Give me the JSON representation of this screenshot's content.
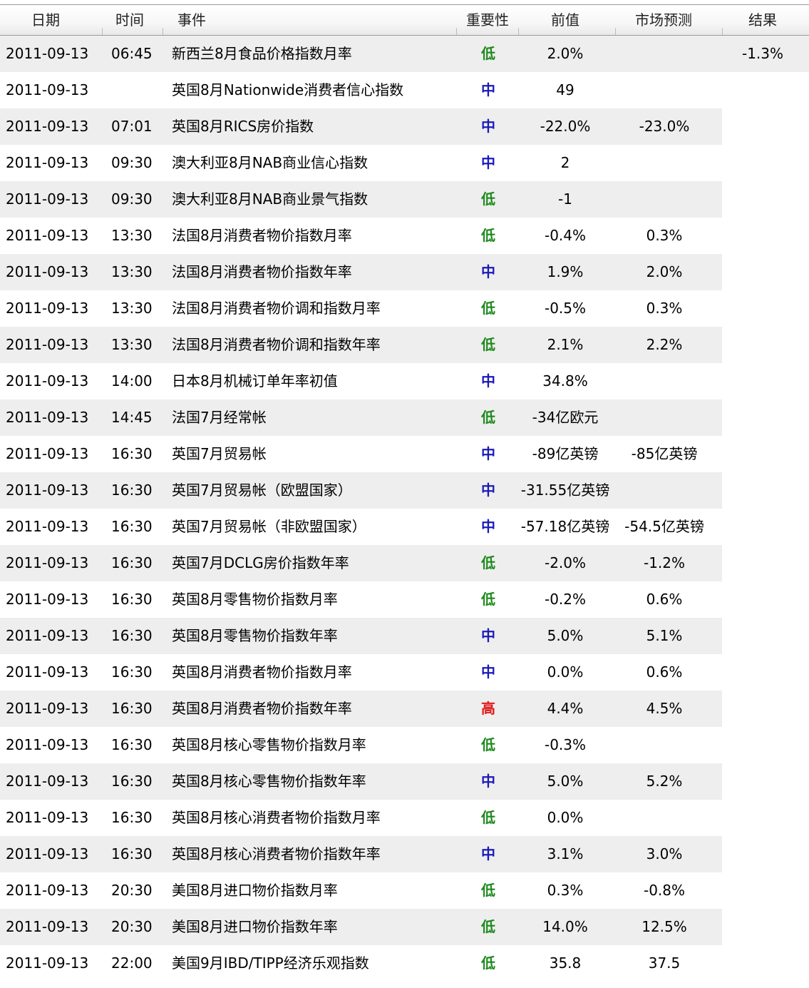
{
  "header": {
    "date": "日期",
    "time": "时间",
    "event": "事件",
    "importance": "重要性",
    "previous": "前值",
    "forecast": "市场预测",
    "result": "结果"
  },
  "importance_colors": {
    "低": "#1f8a1f",
    "中": "#1a1ab8",
    "高": "#e01818"
  },
  "rows": [
    {
      "date": "2011-09-13",
      "time": "06:45",
      "event": "新西兰8月食品价格指数月率",
      "importance": "低",
      "previous": "2.0%",
      "forecast": "",
      "result": "-1.3%"
    },
    {
      "date": "2011-09-13",
      "time": "",
      "event": "英国8月Nationwide消费者信心指数",
      "importance": "中",
      "previous": "49",
      "forecast": "",
      "result": ""
    },
    {
      "date": "2011-09-13",
      "time": "07:01",
      "event": "英国8月RICS房价指数",
      "importance": "中",
      "previous": "-22.0%",
      "forecast": "-23.0%",
      "result": ""
    },
    {
      "date": "2011-09-13",
      "time": "09:30",
      "event": "澳大利亚8月NAB商业信心指数",
      "importance": "中",
      "previous": "2",
      "forecast": "",
      "result": ""
    },
    {
      "date": "2011-09-13",
      "time": "09:30",
      "event": "澳大利亚8月NAB商业景气指数",
      "importance": "低",
      "previous": "-1",
      "forecast": "",
      "result": ""
    },
    {
      "date": "2011-09-13",
      "time": "13:30",
      "event": "法国8月消费者物价指数月率",
      "importance": "低",
      "previous": "-0.4%",
      "forecast": "0.3%",
      "result": ""
    },
    {
      "date": "2011-09-13",
      "time": "13:30",
      "event": "法国8月消费者物价指数年率",
      "importance": "中",
      "previous": "1.9%",
      "forecast": "2.0%",
      "result": ""
    },
    {
      "date": "2011-09-13",
      "time": "13:30",
      "event": "法国8月消费者物价调和指数月率",
      "importance": "低",
      "previous": "-0.5%",
      "forecast": "0.3%",
      "result": ""
    },
    {
      "date": "2011-09-13",
      "time": "13:30",
      "event": "法国8月消费者物价调和指数年率",
      "importance": "低",
      "previous": "2.1%",
      "forecast": "2.2%",
      "result": ""
    },
    {
      "date": "2011-09-13",
      "time": "14:00",
      "event": "日本8月机械订单年率初值",
      "importance": "中",
      "previous": "34.8%",
      "forecast": "",
      "result": ""
    },
    {
      "date": "2011-09-13",
      "time": "14:45",
      "event": "法国7月经常帐",
      "importance": "低",
      "previous": "-34亿欧元",
      "forecast": "",
      "result": ""
    },
    {
      "date": "2011-09-13",
      "time": "16:30",
      "event": "英国7月贸易帐",
      "importance": "中",
      "previous": "-89亿英镑",
      "forecast": "-85亿英镑",
      "result": ""
    },
    {
      "date": "2011-09-13",
      "time": "16:30",
      "event": "英国7月贸易帐（欧盟国家）",
      "importance": "中",
      "previous": "-31.55亿英镑",
      "forecast": "",
      "result": ""
    },
    {
      "date": "2011-09-13",
      "time": "16:30",
      "event": "英国7月贸易帐（非欧盟国家）",
      "importance": "中",
      "previous": "-57.18亿英镑",
      "forecast": "-54.5亿英镑",
      "result": ""
    },
    {
      "date": "2011-09-13",
      "time": "16:30",
      "event": "英国7月DCLG房价指数年率",
      "importance": "低",
      "previous": "-2.0%",
      "forecast": "-1.2%",
      "result": ""
    },
    {
      "date": "2011-09-13",
      "time": "16:30",
      "event": "英国8月零售物价指数月率",
      "importance": "低",
      "previous": "-0.2%",
      "forecast": "0.6%",
      "result": ""
    },
    {
      "date": "2011-09-13",
      "time": "16:30",
      "event": "英国8月零售物价指数年率",
      "importance": "中",
      "previous": "5.0%",
      "forecast": "5.1%",
      "result": ""
    },
    {
      "date": "2011-09-13",
      "time": "16:30",
      "event": "英国8月消费者物价指数月率",
      "importance": "中",
      "previous": "0.0%",
      "forecast": "0.6%",
      "result": ""
    },
    {
      "date": "2011-09-13",
      "time": "16:30",
      "event": "英国8月消费者物价指数年率",
      "importance": "高",
      "previous": "4.4%",
      "forecast": "4.5%",
      "result": ""
    },
    {
      "date": "2011-09-13",
      "time": "16:30",
      "event": "英国8月核心零售物价指数月率",
      "importance": "低",
      "previous": "-0.3%",
      "forecast": "",
      "result": ""
    },
    {
      "date": "2011-09-13",
      "time": "16:30",
      "event": "英国8月核心零售物价指数年率",
      "importance": "中",
      "previous": "5.0%",
      "forecast": "5.2%",
      "result": ""
    },
    {
      "date": "2011-09-13",
      "time": "16:30",
      "event": "英国8月核心消费者物价指数月率",
      "importance": "低",
      "previous": "0.0%",
      "forecast": "",
      "result": ""
    },
    {
      "date": "2011-09-13",
      "time": "16:30",
      "event": "英国8月核心消费者物价指数年率",
      "importance": "中",
      "previous": "3.1%",
      "forecast": "3.0%",
      "result": ""
    },
    {
      "date": "2011-09-13",
      "time": "20:30",
      "event": "美国8月进口物价指数月率",
      "importance": "低",
      "previous": "0.3%",
      "forecast": "-0.8%",
      "result": ""
    },
    {
      "date": "2011-09-13",
      "time": "20:30",
      "event": "美国8月进口物价指数年率",
      "importance": "低",
      "previous": "14.0%",
      "forecast": "12.5%",
      "result": ""
    },
    {
      "date": "2011-09-13",
      "time": "22:00",
      "event": "美国9月IBD/TIPP经济乐观指数",
      "importance": "低",
      "previous": "35.8",
      "forecast": "37.5",
      "result": ""
    }
  ]
}
